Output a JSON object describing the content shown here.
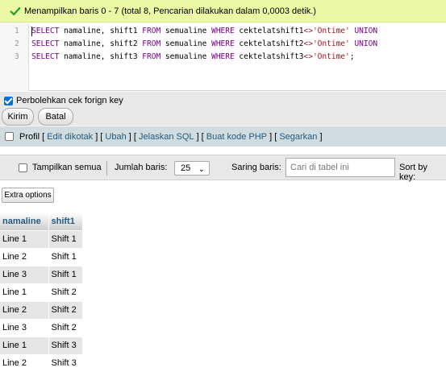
{
  "message": {
    "text": "Menampilkan baris 0 - 7 (total 8, Pencarian dilakukan dalam 0,0003 detik.)",
    "icon": "check-icon"
  },
  "sql": {
    "lines": [
      {
        "num": "1",
        "select": "SELECT",
        "cols": " namaline, shift1 ",
        "from": "FROM",
        "table": " semualine ",
        "where": "WHERE",
        "col": " cektelatshift1",
        "op": "<>",
        "value": "'Ontime'",
        "tail_kw": " UNION",
        "tail": ""
      },
      {
        "num": "2",
        "select": "SELECT",
        "cols": " namaline, shift2 ",
        "from": "FROM",
        "table": " semualine ",
        "where": "WHERE",
        "col": " cektelatshift2",
        "op": "<>",
        "value": "'Ontime'",
        "tail_kw": " UNION",
        "tail": ""
      },
      {
        "num": "3",
        "select": "SELECT",
        "cols": " namaline, shift3 ",
        "from": "FROM",
        "table": " semualine ",
        "where": "WHERE",
        "col": " cektelatshift3",
        "op": "<>",
        "value": "'Ontime'",
        "tail_kw": "",
        "tail": ";"
      }
    ]
  },
  "foreign_key": {
    "label": "Perbolehkan cek forign key",
    "checked": true
  },
  "buttons": {
    "submit": "Kirim",
    "cancel": "Batal"
  },
  "profile": {
    "label": "Profil",
    "links": [
      "Edit dikotak",
      "Ubah",
      "Jelaskan SQL",
      "Buat kode PHP",
      "Segarkan"
    ],
    "open": "[",
    "close": "]",
    "between": "] ["
  },
  "nav": {
    "show_all": "Tampilkan semua",
    "rows_label": "Jumlah baris:",
    "rows_value": "25",
    "filter_label": "Saring baris:",
    "filter_placeholder": "Cari di tabel ini",
    "sort_label": "Sort by key:"
  },
  "extra_options": "Extra options",
  "table": {
    "headers": [
      "namaline",
      "shift1"
    ],
    "rows": [
      [
        "Line 1",
        "Shift 1"
      ],
      [
        "Line 2",
        "Shift 1"
      ],
      [
        "Line 3",
        "Shift 1"
      ],
      [
        "Line 1",
        "Shift 2"
      ],
      [
        "Line 2",
        "Shift 2"
      ],
      [
        "Line 3",
        "Shift 2"
      ],
      [
        "Line 1",
        "Shift 3"
      ],
      [
        "Line 2",
        "Shift 3"
      ]
    ]
  },
  "colors": {
    "success_bg": "#ebf8a4",
    "link": "#235a81",
    "keyword": "#770088",
    "string": "#aa1111"
  }
}
